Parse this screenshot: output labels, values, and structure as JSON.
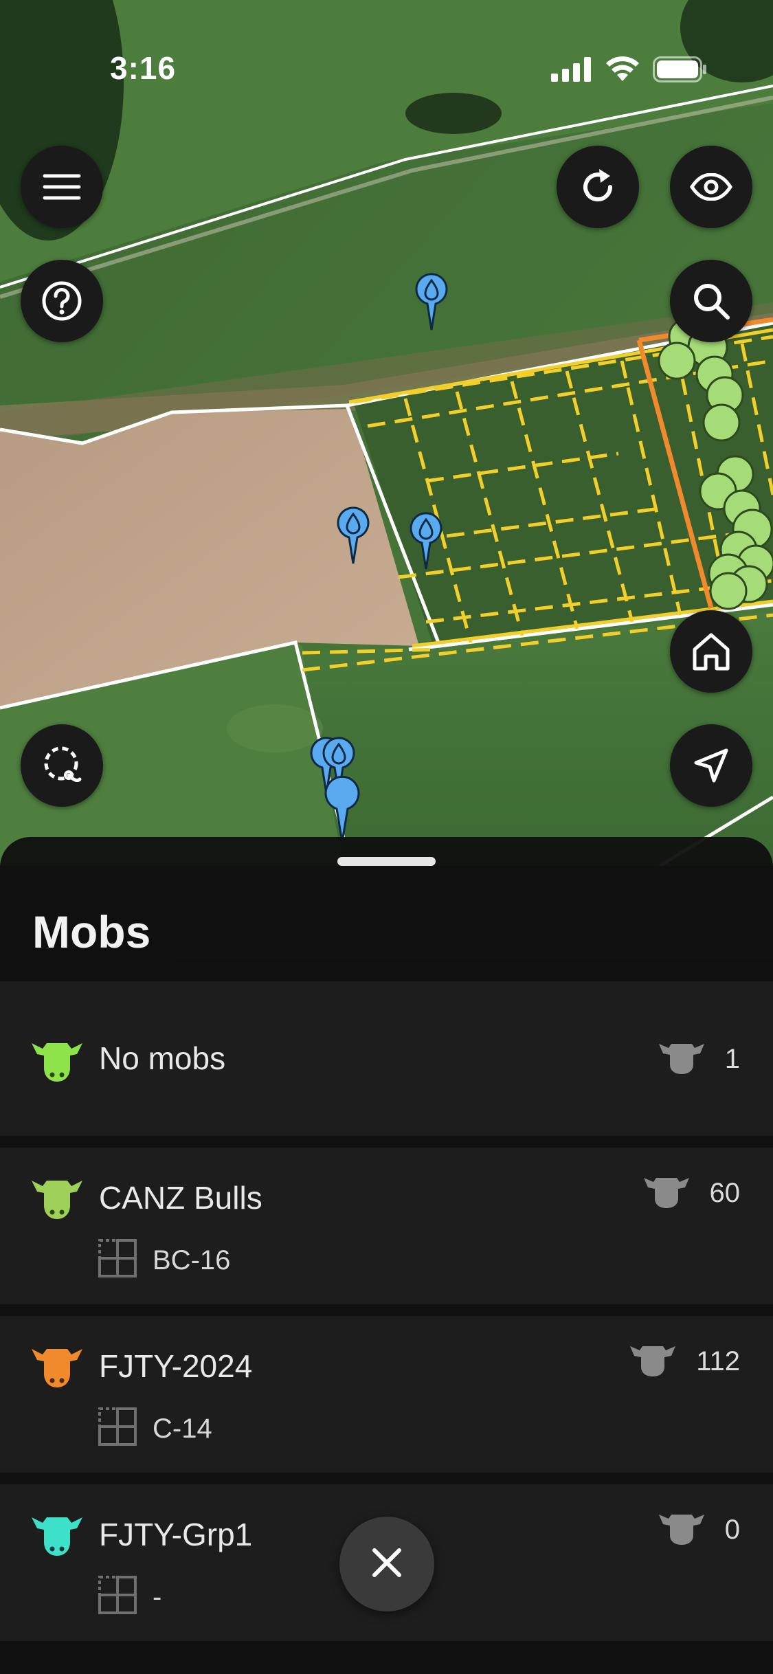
{
  "status_bar": {
    "time": "3:16",
    "signal_icon": "cellular-signal-icon",
    "wifi_icon": "wifi-icon",
    "battery_icon": "battery-icon"
  },
  "map_controls": {
    "menu_icon": "menu-icon",
    "help_icon": "help-icon",
    "refresh_icon": "refresh-icon",
    "visibility_icon": "eye-icon",
    "search_icon": "search-icon",
    "home_icon": "home-icon",
    "lasso_icon": "lasso-select-icon",
    "navigate_icon": "navigation-arrow-icon"
  },
  "sheet": {
    "title": "Mobs"
  },
  "mobs": [
    {
      "name": "No mobs",
      "count": "1",
      "paddock": "",
      "color": "#8fe34a"
    },
    {
      "name": "CANZ Bulls",
      "count": "60",
      "paddock": "BC-16",
      "color": "#9fd05a"
    },
    {
      "name": "FJTY-2024",
      "count": "112",
      "paddock": "C-14",
      "color": "#f08a2c"
    },
    {
      "name": "FJTY-Grp1",
      "count": "0",
      "paddock": "-",
      "color": "#3de0c8"
    }
  ],
  "close_button_icon": "close-icon",
  "colors": {
    "paddock_outline": "#ffffff",
    "highlight_paddock": "#f2cf2a",
    "selected_paddock": "#f08a2c",
    "marker_blue": "#5aaaf0",
    "mob_marker_green": "#a6dc78"
  }
}
